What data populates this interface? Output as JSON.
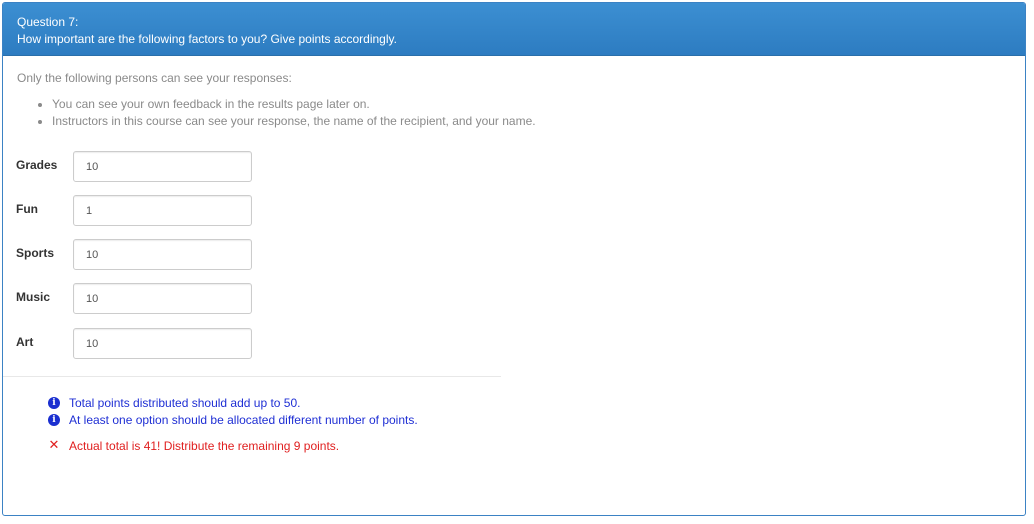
{
  "question": {
    "number_label": "Question 7:",
    "text": "How important are the following factors to you? Give points accordingly."
  },
  "visibility": {
    "intro": "Only the following persons can see your responses:",
    "items": [
      "You can see your own feedback in the results page later on.",
      "Instructors in this course can see your response, the name of the recipient, and your name."
    ]
  },
  "options": [
    {
      "label": "Grades",
      "value": "10"
    },
    {
      "label": "Fun",
      "value": "1"
    },
    {
      "label": "Sports",
      "value": "10"
    },
    {
      "label": "Music",
      "value": "10"
    },
    {
      "label": "Art",
      "value": "10"
    }
  ],
  "messages": {
    "info": [
      "Total points distributed should add up to 50.",
      "At least one option should be allocated different number of points."
    ],
    "error": "Actual total is 41! Distribute the remaining 9 points."
  },
  "icons": {
    "info": "info-icon",
    "error": "cross-icon"
  },
  "colors": {
    "header": "#337ab7",
    "info_text": "#1f2fd4",
    "error_text": "#e02020"
  }
}
